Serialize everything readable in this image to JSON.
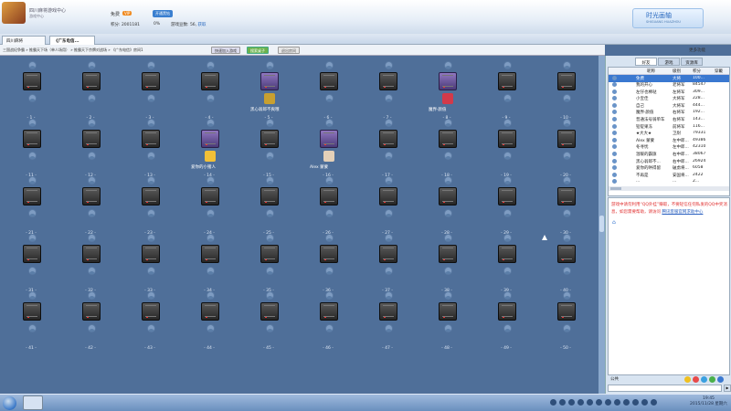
{
  "header": {
    "app_title": "四川麻将游戏中心",
    "app_subtitle": "游戏中心",
    "user_name": "免费",
    "vip_badge": "VIP",
    "open_vip": "开通黑钻",
    "points": "积分: 2001181",
    "rate": "0%",
    "game_coins": "游戏豆数: 56,",
    "game_coins_action": "获取",
    "brand_name": "时光画轴",
    "brand_sub": "SHIGUANG HUAZHOU",
    "brand_caption": "QQ游戏美女主播秀"
  },
  "tabs": [
    {
      "label": "四川麻将"
    },
    {
      "label": "《广东电信..."
    }
  ],
  "toolbar": {
    "breadcrumb": "三国战纪争霸 » 推霸天下场（单人场用） » 推霸天下京牌对战场 » 《广东电信》房间1",
    "quick_join": "快速加入游戏",
    "find_table": "搜索桌子",
    "exit_room": "退出房间",
    "more": "更多功能"
  },
  "room": {
    "rows": [
      [
        "- 1 -",
        "- 2 -",
        "- 3 -",
        "- 4 -",
        "- 5 -",
        "- 6 -",
        "- 7 -",
        "- 8 -",
        "- 9 -",
        "- 10 -"
      ],
      [
        "- 11 -",
        "- 12 -",
        "- 13 -",
        "- 14 -",
        "- 15 -",
        "- 16 -",
        "- 17 -",
        "- 18 -",
        "- 19 -",
        "- 20 -"
      ],
      [
        "- 21 -",
        "- 22 -",
        "- 23 -",
        "- 24 -",
        "- 25 -",
        "- 26 -",
        "- 27 -",
        "- 28 -",
        "- 29 -",
        "- 30 -"
      ],
      [
        "- 31 -",
        "- 32 -",
        "- 33 -",
        "- 34 -",
        "- 35 -",
        "- 36 -",
        "- 37 -",
        "- 38 -",
        "- 39 -",
        "- 40 -"
      ],
      [
        "- 41 -",
        "- 42 -",
        "- 43 -",
        "- 44 -",
        "- 45 -",
        "- 46 -",
        "- 47 -",
        "- 48 -",
        "- 49 -",
        "- 50 -"
      ]
    ],
    "active_tables": [
      5,
      8,
      14,
      16
    ],
    "players": [
      {
        "name": "黑心翁郎不爽哦",
        "table": 5,
        "color": "#c8a030"
      },
      {
        "name": "魔界·颜值",
        "table": 8,
        "color": "#d23a4a"
      },
      {
        "name": "爱你的小猪人",
        "table": 14,
        "color": "#f2c037"
      },
      {
        "name": "Alex 蒙蒙",
        "table": 16,
        "color": "#e4d0b8"
      }
    ]
  },
  "side": {
    "tabs": [
      "好友",
      "游戏",
      "资源库"
    ],
    "list_headers": [
      "昵称",
      "级别",
      "积分",
      "穿戴"
    ],
    "players": [
      {
        "name": "免费",
        "level": "大将",
        "score": "100...",
        "sel": true
      },
      {
        "name": "我的开心",
        "level": "老将军",
        "score": "84547"
      },
      {
        "name": "左仔也棒哒",
        "level": "左将军",
        "score": "309..."
      },
      {
        "name": "小宝佳",
        "level": "大将军",
        "score": "228..."
      },
      {
        "name": "自己",
        "level": "大将军",
        "score": "444..."
      },
      {
        "name": "魔界·颜值",
        "level": "右将军",
        "score": "192..."
      },
      {
        "name": "普通法号骑单车",
        "level": "右将军",
        "score": "143..."
      },
      {
        "name": "铅锭果冻",
        "level": "前将军",
        "score": "116..."
      },
      {
        "name": "★大大★",
        "level": "卫尉",
        "score": "79331"
      },
      {
        "name": "Alex 蒙蒙",
        "level": "左中郎...",
        "score": "49386"
      },
      {
        "name": "冬寻忧",
        "level": "左中郎...",
        "score": "42310"
      },
      {
        "name": "温暖的霸旗",
        "level": "右中郎...",
        "score": "38067"
      },
      {
        "name": "黑心翁郎不...",
        "level": "右中郎...",
        "score": "26924"
      },
      {
        "name": "爱你的哄得留",
        "level": "破虏将...",
        "score": "6058"
      },
      {
        "name": "不再是",
        "level": "安国将...",
        "score": "2422"
      },
      {
        "name": "...",
        "level": "...",
        "score": "2..."
      }
    ],
    "system_message": "游戏中请勿利用“QQ外挂”赚取，不要轻信任何私发的QQ中奖消息，如您需要帮助，请访问",
    "system_link": "腾讯客服官网求助中心",
    "chat_scope": "公共",
    "send": "▶"
  },
  "taskbar": {
    "time": "19:45",
    "date": "2015/11/28 星期六"
  }
}
